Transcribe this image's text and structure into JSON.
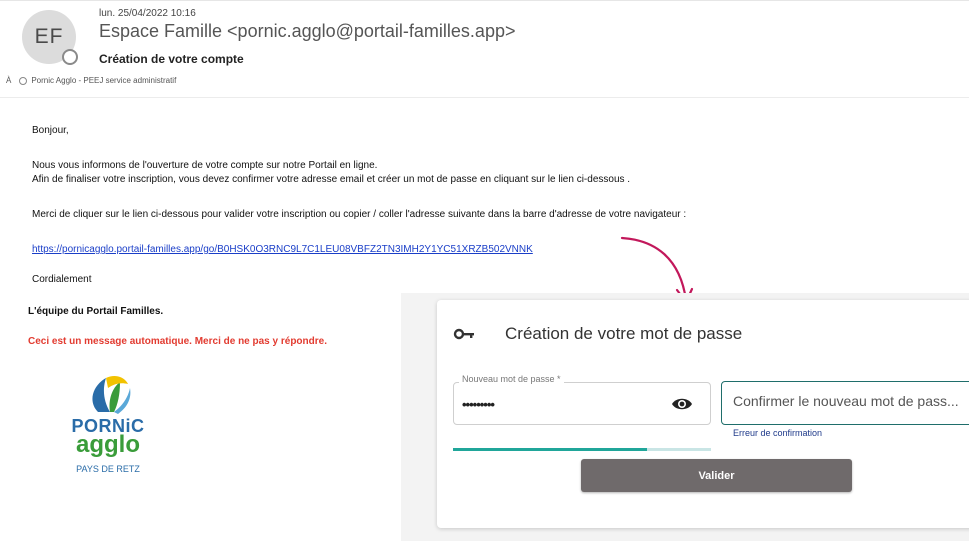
{
  "email": {
    "avatar_initials": "EF",
    "date": "lun. 25/04/2022 10:16",
    "sender": "Espace Famille <pornic.agglo@portail-familles.app>",
    "subject": "Création de votre compte",
    "to_prefix": "À",
    "to_recipient": "Pornic Agglo - PEEJ service administratif"
  },
  "body": {
    "greeting": "Bonjour,",
    "para1_line1": "Nous vous informons de l'ouverture de votre compte sur notre Portail en ligne.",
    "para1_line2": "Afin de finaliser votre inscription, vous devez confirmer votre adresse email et créer un mot de passe en cliquant sur le lien ci-dessous .",
    "para2": "Merci de cliquer sur le lien ci-dessous pour valider votre inscription ou copier / coller l'adresse suivante dans la barre d'adresse de votre navigateur :",
    "link": "https://pornicagglo.portail-familles.app/go/B0HSK0O3RNC9L7C1LEU08VBFZ2TN3IMH2Y1YC51XRZB502VNNK",
    "closing": "Cordialement",
    "team": "L'équipe du Portail Familles.",
    "auto_message": "Ceci est un message automatique. Merci de ne pas y répondre."
  },
  "logo": {
    "line1": "PORNiC",
    "line2": "agglo",
    "line3": "PAYS DE RETZ"
  },
  "password_form": {
    "title": "Création de votre mot de passe",
    "new_password_label": "Nouveau mot de passe *",
    "new_password_value": "•••••••••",
    "confirm_placeholder": "Confirmer le nouveau mot de pass...",
    "confirm_error": "Erreur de confirmation",
    "strength": 0.75,
    "submit_label": "Valider"
  },
  "colors": {
    "link": "#1a3ec8",
    "warning": "#e23b30",
    "accent_teal": "#20a69a",
    "button": "#6f6a6b",
    "arrow": "#c2185b"
  },
  "icons": {
    "key": "key-icon",
    "eye": "eye-icon",
    "arrow": "curved-arrow-icon"
  }
}
